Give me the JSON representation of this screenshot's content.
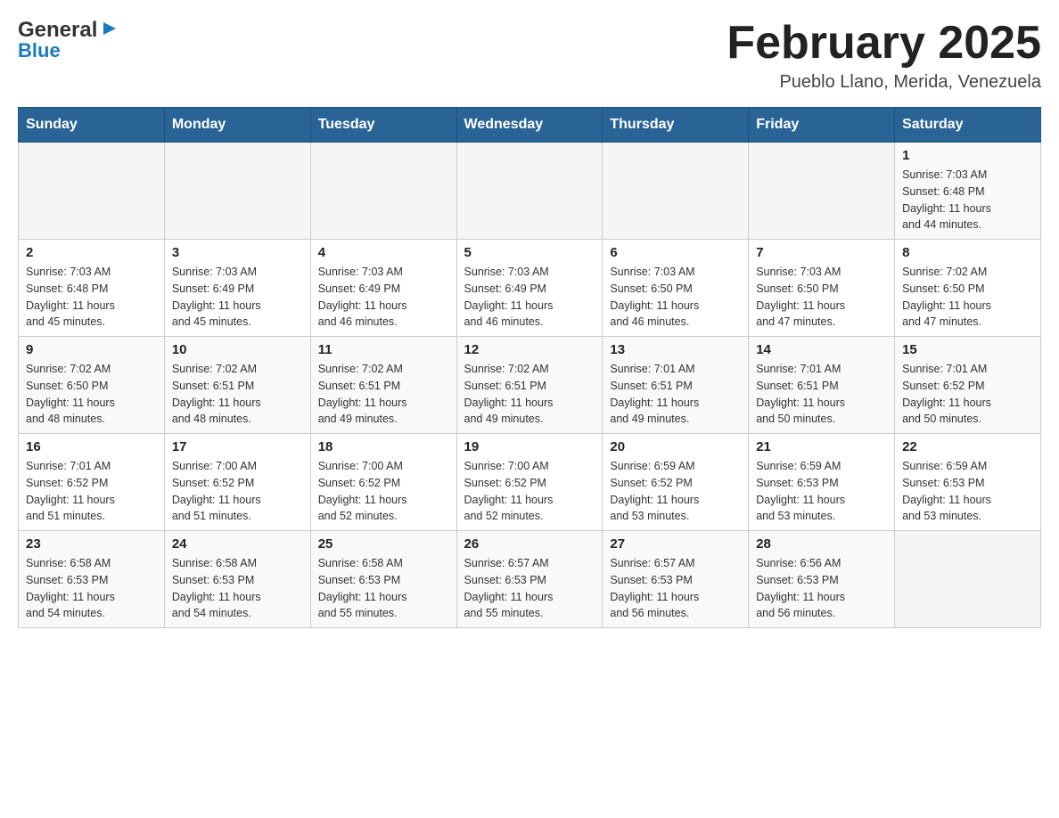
{
  "header": {
    "logo_line1": "General",
    "logo_line2": "Blue",
    "title": "February 2025",
    "subtitle": "Pueblo Llano, Merida, Venezuela"
  },
  "calendar": {
    "days_of_week": [
      "Sunday",
      "Monday",
      "Tuesday",
      "Wednesday",
      "Thursday",
      "Friday",
      "Saturday"
    ],
    "weeks": [
      {
        "days": [
          {
            "number": "",
            "info": ""
          },
          {
            "number": "",
            "info": ""
          },
          {
            "number": "",
            "info": ""
          },
          {
            "number": "",
            "info": ""
          },
          {
            "number": "",
            "info": ""
          },
          {
            "number": "",
            "info": ""
          },
          {
            "number": "1",
            "info": "Sunrise: 7:03 AM\nSunset: 6:48 PM\nDaylight: 11 hours\nand 44 minutes."
          }
        ]
      },
      {
        "days": [
          {
            "number": "2",
            "info": "Sunrise: 7:03 AM\nSunset: 6:48 PM\nDaylight: 11 hours\nand 45 minutes."
          },
          {
            "number": "3",
            "info": "Sunrise: 7:03 AM\nSunset: 6:49 PM\nDaylight: 11 hours\nand 45 minutes."
          },
          {
            "number": "4",
            "info": "Sunrise: 7:03 AM\nSunset: 6:49 PM\nDaylight: 11 hours\nand 46 minutes."
          },
          {
            "number": "5",
            "info": "Sunrise: 7:03 AM\nSunset: 6:49 PM\nDaylight: 11 hours\nand 46 minutes."
          },
          {
            "number": "6",
            "info": "Sunrise: 7:03 AM\nSunset: 6:50 PM\nDaylight: 11 hours\nand 46 minutes."
          },
          {
            "number": "7",
            "info": "Sunrise: 7:03 AM\nSunset: 6:50 PM\nDaylight: 11 hours\nand 47 minutes."
          },
          {
            "number": "8",
            "info": "Sunrise: 7:02 AM\nSunset: 6:50 PM\nDaylight: 11 hours\nand 47 minutes."
          }
        ]
      },
      {
        "days": [
          {
            "number": "9",
            "info": "Sunrise: 7:02 AM\nSunset: 6:50 PM\nDaylight: 11 hours\nand 48 minutes."
          },
          {
            "number": "10",
            "info": "Sunrise: 7:02 AM\nSunset: 6:51 PM\nDaylight: 11 hours\nand 48 minutes."
          },
          {
            "number": "11",
            "info": "Sunrise: 7:02 AM\nSunset: 6:51 PM\nDaylight: 11 hours\nand 49 minutes."
          },
          {
            "number": "12",
            "info": "Sunrise: 7:02 AM\nSunset: 6:51 PM\nDaylight: 11 hours\nand 49 minutes."
          },
          {
            "number": "13",
            "info": "Sunrise: 7:01 AM\nSunset: 6:51 PM\nDaylight: 11 hours\nand 49 minutes."
          },
          {
            "number": "14",
            "info": "Sunrise: 7:01 AM\nSunset: 6:51 PM\nDaylight: 11 hours\nand 50 minutes."
          },
          {
            "number": "15",
            "info": "Sunrise: 7:01 AM\nSunset: 6:52 PM\nDaylight: 11 hours\nand 50 minutes."
          }
        ]
      },
      {
        "days": [
          {
            "number": "16",
            "info": "Sunrise: 7:01 AM\nSunset: 6:52 PM\nDaylight: 11 hours\nand 51 minutes."
          },
          {
            "number": "17",
            "info": "Sunrise: 7:00 AM\nSunset: 6:52 PM\nDaylight: 11 hours\nand 51 minutes."
          },
          {
            "number": "18",
            "info": "Sunrise: 7:00 AM\nSunset: 6:52 PM\nDaylight: 11 hours\nand 52 minutes."
          },
          {
            "number": "19",
            "info": "Sunrise: 7:00 AM\nSunset: 6:52 PM\nDaylight: 11 hours\nand 52 minutes."
          },
          {
            "number": "20",
            "info": "Sunrise: 6:59 AM\nSunset: 6:52 PM\nDaylight: 11 hours\nand 53 minutes."
          },
          {
            "number": "21",
            "info": "Sunrise: 6:59 AM\nSunset: 6:53 PM\nDaylight: 11 hours\nand 53 minutes."
          },
          {
            "number": "22",
            "info": "Sunrise: 6:59 AM\nSunset: 6:53 PM\nDaylight: 11 hours\nand 53 minutes."
          }
        ]
      },
      {
        "days": [
          {
            "number": "23",
            "info": "Sunrise: 6:58 AM\nSunset: 6:53 PM\nDaylight: 11 hours\nand 54 minutes."
          },
          {
            "number": "24",
            "info": "Sunrise: 6:58 AM\nSunset: 6:53 PM\nDaylight: 11 hours\nand 54 minutes."
          },
          {
            "number": "25",
            "info": "Sunrise: 6:58 AM\nSunset: 6:53 PM\nDaylight: 11 hours\nand 55 minutes."
          },
          {
            "number": "26",
            "info": "Sunrise: 6:57 AM\nSunset: 6:53 PM\nDaylight: 11 hours\nand 55 minutes."
          },
          {
            "number": "27",
            "info": "Sunrise: 6:57 AM\nSunset: 6:53 PM\nDaylight: 11 hours\nand 56 minutes."
          },
          {
            "number": "28",
            "info": "Sunrise: 6:56 AM\nSunset: 6:53 PM\nDaylight: 11 hours\nand 56 minutes."
          },
          {
            "number": "",
            "info": ""
          }
        ]
      }
    ]
  }
}
